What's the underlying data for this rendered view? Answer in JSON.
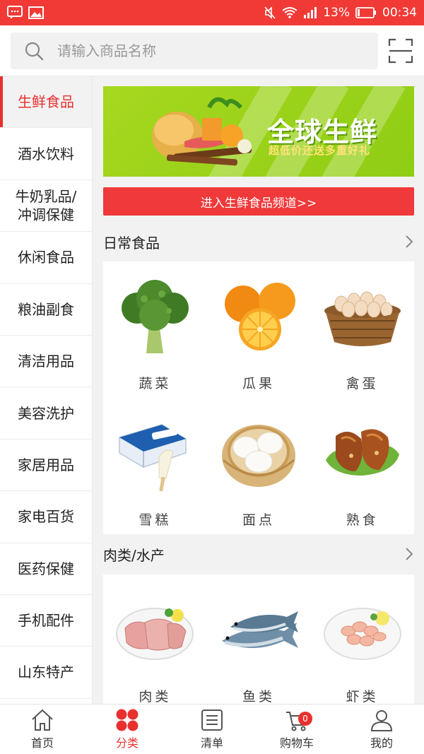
{
  "status_bar": {
    "battery": "13%",
    "time": "00:34"
  },
  "search": {
    "placeholder": "请输入商品名称"
  },
  "categories": [
    {
      "label": "生鲜食品",
      "active": true
    },
    {
      "label": "酒水饮料"
    },
    {
      "label": "牛奶乳品/冲调保健"
    },
    {
      "label": "休闲食品"
    },
    {
      "label": "粮油副食"
    },
    {
      "label": "清洁用品"
    },
    {
      "label": "美容洗护"
    },
    {
      "label": "家居用品"
    },
    {
      "label": "家电百货"
    },
    {
      "label": "医药保健"
    },
    {
      "label": "手机配件"
    },
    {
      "label": "山东特产"
    }
  ],
  "banner": {
    "title": "全球生鲜",
    "subtitle": "超低价还送多重好礼"
  },
  "channel_button": "进入生鲜食品频道>>",
  "sections": [
    {
      "title": "日常食品",
      "items": [
        {
          "label": "蔬菜",
          "icon": "broccoli-icon"
        },
        {
          "label": "瓜果",
          "icon": "orange-icon"
        },
        {
          "label": "禽蛋",
          "icon": "egg-basket-icon"
        },
        {
          "label": "雪糕",
          "icon": "ice-cream-icon"
        },
        {
          "label": "面点",
          "icon": "steamed-bun-icon"
        },
        {
          "label": "熟食",
          "icon": "cooked-meat-icon"
        }
      ]
    },
    {
      "title": "肉类/水产",
      "items": [
        {
          "label": "肉类",
          "icon": "meat-plate-icon"
        },
        {
          "label": "鱼类",
          "icon": "fish-icon"
        },
        {
          "label": "虾类",
          "icon": "shrimp-plate-icon"
        }
      ]
    }
  ],
  "bottom_nav": [
    {
      "label": "首页",
      "icon": "home-icon"
    },
    {
      "label": "分类",
      "icon": "category-icon",
      "active": true
    },
    {
      "label": "清单",
      "icon": "list-icon"
    },
    {
      "label": "购物车",
      "icon": "cart-icon",
      "badge": "0"
    },
    {
      "label": "我的",
      "icon": "user-icon"
    }
  ],
  "colors": {
    "accent": "#e8312f",
    "status_bar": "#f13a36",
    "banner": "#a6d81f"
  }
}
